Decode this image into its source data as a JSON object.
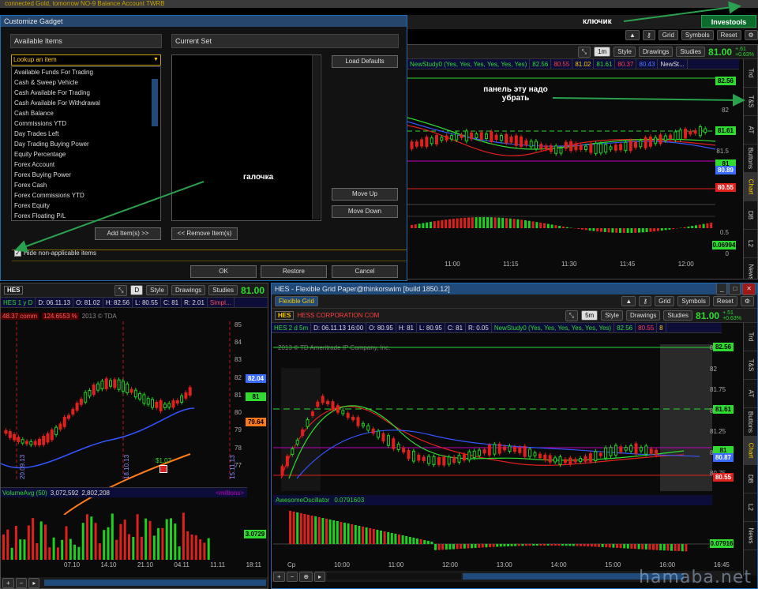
{
  "top": {
    "strip_text": "connected   Gold, tomorrow   NO-9 Balance   Account TWRB",
    "investools": "Investools",
    "app_buttons": [
      "Grid",
      "Symbols",
      "Reset"
    ]
  },
  "annotations": {
    "key": "ключик",
    "panel": "панель эту надо убрать",
    "checkbox": "галочка"
  },
  "dialog": {
    "title": "Customize Gadget",
    "available_header": "Available Items",
    "current_header": "Current Set",
    "lookup": "Lookup an item",
    "items": [
      "Available Funds For Trading",
      "Cash & Sweep Vehicle",
      "Cash Available For Trading",
      "Cash Available For Withdrawal",
      "Cash Balance",
      "Commissions YTD",
      "Day Trades Left",
      "Day Trading Buying Power",
      "Equity Percentage",
      "Forex Account",
      "Forex Buying Power",
      "Forex Cash",
      "Forex Commissions YTD",
      "Forex Equity",
      "Forex Floating P/L"
    ],
    "load_defaults": "Load Defaults",
    "add_items": "Add Item(s) >>",
    "remove_items": "<< Remove Item(s)",
    "move_up": "Move Up",
    "move_down": "Move Down",
    "hide_label": "Hide non-applicable items",
    "ok": "OK",
    "restore": "Restore",
    "cancel": "Cancel"
  },
  "top_chart": {
    "style": "Style",
    "drawings": "Drawings",
    "studies": "Studies",
    "timeframe": "1m",
    "price": "81.00",
    "change": "+.61",
    "change_pct": "+0.63%",
    "study_label": "NewStudy0 (Yes, Yes, Yes, Yes, Yes, Yes)",
    "study_vals": [
      "82.56",
      "80.55",
      "81.02",
      "81.61",
      "80.37",
      "80.43",
      "NewSt..."
    ],
    "badges": [
      "82.56",
      "81.61",
      "81",
      "80.89",
      "80.55",
      "0.06994"
    ],
    "yticks": [
      "82",
      "81.5",
      "81",
      "0.5",
      "0"
    ],
    "times": [
      "11:00",
      "11:15",
      "11:30",
      "11:45",
      "12:00"
    ],
    "vtabs": [
      "Trd",
      "T&S",
      "AT",
      "Buttons",
      "Chart",
      "DB",
      "L2",
      "News"
    ]
  },
  "left_chart": {
    "symbol": "HES",
    "style": "Style",
    "drawings": "Drawings",
    "studies": "Studies",
    "tf": "D",
    "price": "81.00",
    "quote": [
      "HES 1 y D",
      "D: 06.11.13",
      "O: 81.02",
      "H: 82.56",
      "L: 80.55",
      "C: 81",
      "R: 2.01",
      "Simpl..."
    ],
    "sub": [
      "48.37 comm",
      "124.6553 %",
      "2013 © TDA"
    ],
    "badges": [
      "82.04",
      "81",
      "79.64",
      "3.0729"
    ],
    "yticks": [
      "85",
      "84",
      "83",
      "82",
      "81",
      "80",
      "79",
      "78",
      "77"
    ],
    "dividend": "$1.07",
    "volume_label": "VolumeAvg (50)",
    "volume_vals": [
      "3,072,592",
      "2,802,208"
    ],
    "millions": "<millions>",
    "dates": [
      "07.10",
      "14.10",
      "21.10",
      "04.11",
      "11.11",
      "18:11"
    ],
    "vlabels": [
      "20.09.13",
      "18.10.13",
      "15.11.13"
    ]
  },
  "grid_window": {
    "title": "HES - Flexible Grid Paper@thinkorswim [build 1850.12]",
    "grid_name": "Flexible Grid",
    "buttons": [
      "Grid",
      "Symbols",
      "Reset"
    ],
    "symbol": "HES",
    "company": "HESS CORPORATION COM",
    "style": "Style",
    "drawings": "Drawings",
    "studies": "Studies",
    "tf": "5m",
    "price": "81.00",
    "change": "+.51",
    "change_pct": "+0.63%",
    "quote": [
      "HES 2 d 5m",
      "D: 06.11.13 16:00",
      "O: 80.95",
      "H: 81",
      "L: 80.95",
      "C: 81",
      "R: 0.05",
      "NewStudy0 (Yes, Yes, Yes, Yes, Yes, Yes)",
      "82.56",
      "80.55",
      "8"
    ],
    "copyright": "2013 © TD Ameritrade IP Company, Inc.",
    "badges": [
      "82.56",
      "81.61",
      "81",
      "80.87",
      "80.55"
    ],
    "yticks": [
      "82.25",
      "82",
      "81.75",
      "81.5",
      "81.25",
      "81",
      "80.75"
    ],
    "ao_label": "AwesomeOscillator",
    "ao_val": "0.0791603",
    "ao_badge": "0.07916",
    "times": [
      "Cp",
      "10:00",
      "11:00",
      "12:00",
      "13:00",
      "14:00",
      "15:00",
      "16:00",
      "16:45"
    ],
    "vtabs": [
      "Trd",
      "T&S",
      "AT",
      "Buttons",
      "Chart",
      "DB",
      "L2",
      "News"
    ]
  },
  "watermark": "hamaba.net",
  "colors": {
    "up": "#1fd11f",
    "down": "#e0201c",
    "accent_blue": "#1f6db2",
    "magenta": "#c000c0"
  }
}
